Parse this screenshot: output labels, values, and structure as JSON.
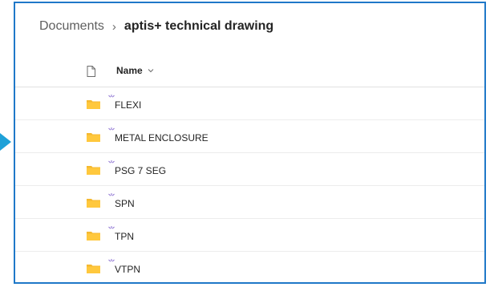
{
  "breadcrumb": {
    "root": "Documents",
    "separator": "›",
    "current": "aptis+ technical drawing"
  },
  "header": {
    "file_type_icon": "document-icon",
    "name_label": "Name",
    "sort_icon": "chevron-down-icon"
  },
  "items": [
    {
      "label": "FLEXI",
      "icon": "folder-icon",
      "new_badge": "new-item-sparkle-icon"
    },
    {
      "label": "METAL ENCLOSURE",
      "icon": "folder-icon",
      "new_badge": "new-item-sparkle-icon"
    },
    {
      "label": "PSG 7 SEG",
      "icon": "folder-icon",
      "new_badge": "new-item-sparkle-icon"
    },
    {
      "label": "SPN",
      "icon": "folder-icon",
      "new_badge": "new-item-sparkle-icon"
    },
    {
      "label": "TPN",
      "icon": "folder-icon",
      "new_badge": "new-item-sparkle-icon"
    },
    {
      "label": "VTPN",
      "icon": "folder-icon",
      "new_badge": "new-item-sparkle-icon"
    }
  ],
  "colors": {
    "frame_border": "#1f78c8",
    "pointer_arrow": "#1ea1d8",
    "folder": "#f5b931",
    "new_badge": "#8a6fd1"
  }
}
